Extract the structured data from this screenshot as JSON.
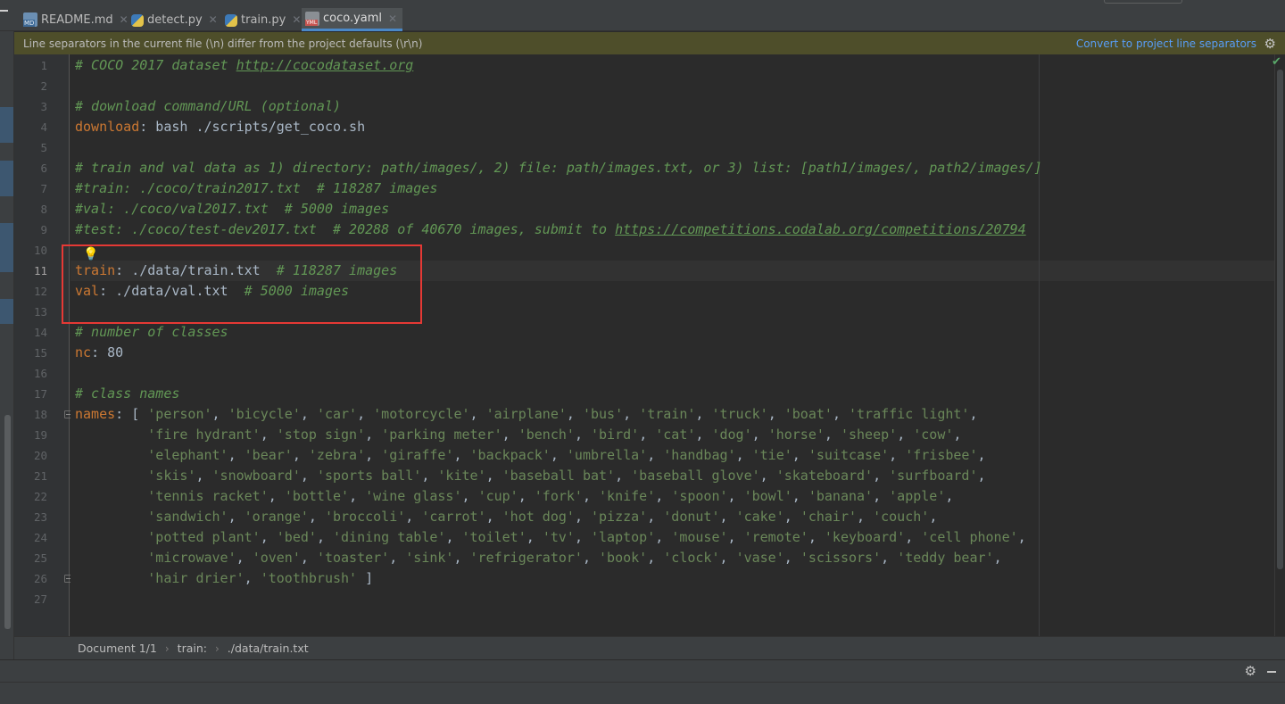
{
  "tabs": [
    {
      "label": "README.md",
      "icon": "markdown-file-icon"
    },
    {
      "label": "detect.py",
      "icon": "python-file-icon"
    },
    {
      "label": "train.py",
      "icon": "python-file-icon"
    },
    {
      "label": "coco.yaml",
      "icon": "yaml-file-icon",
      "active": true
    }
  ],
  "banner": {
    "message": "Line separators in the current file (\\n) differ from the project defaults (\\r\\n)",
    "action": "Convert to project line separators"
  },
  "editor": {
    "current_line": 11,
    "line_numbers": [
      "1",
      "2",
      "3",
      "4",
      "5",
      "6",
      "7",
      "8",
      "9",
      "10",
      "11",
      "12",
      "13",
      "14",
      "15",
      "16",
      "17",
      "18",
      "19",
      "20",
      "21",
      "22",
      "23",
      "24",
      "25",
      "26",
      "27"
    ],
    "lines": [
      [
        {
          "t": "c",
          "v": "# COCO 2017 dataset "
        },
        {
          "t": "cu",
          "v": "http://cocodataset.org"
        }
      ],
      [],
      [
        {
          "t": "c",
          "v": "# download command/URL (optional)"
        }
      ],
      [
        {
          "t": "k",
          "v": "download"
        },
        {
          "t": "p",
          "v": ": bash ./scripts/get_coco.sh"
        }
      ],
      [],
      [
        {
          "t": "c",
          "v": "# train and val data as 1) directory: path/images/, 2) file: path/images.txt, or 3) list: [path1/images/, path2/images/]"
        }
      ],
      [
        {
          "t": "c",
          "v": "#train: ./coco/train2017.txt  # 118287 images"
        }
      ],
      [
        {
          "t": "c",
          "v": "#val: ./coco/val2017.txt  # 5000 images"
        }
      ],
      [
        {
          "t": "c",
          "v": "#test: ./coco/test-dev2017.txt  # 20288 of 40670 images, submit to "
        },
        {
          "t": "cu",
          "v": "https://competitions.codalab.org/competitions/20794"
        }
      ],
      [],
      [
        {
          "t": "k",
          "v": "train"
        },
        {
          "t": "p",
          "v": ": ./data/train.txt  "
        },
        {
          "t": "c",
          "v": "# 118287 images"
        }
      ],
      [
        {
          "t": "k",
          "v": "val"
        },
        {
          "t": "p",
          "v": ": ./data/val.txt  "
        },
        {
          "t": "c",
          "v": "# 5000 images"
        }
      ],
      [],
      [
        {
          "t": "c",
          "v": "# number of classes"
        }
      ],
      [
        {
          "t": "k",
          "v": "nc"
        },
        {
          "t": "p",
          "v": ": 80"
        }
      ],
      [],
      [
        {
          "t": "c",
          "v": "# class names"
        }
      ],
      [
        {
          "t": "k",
          "v": "names"
        },
        {
          "t": "p",
          "v": ": [ "
        },
        {
          "t": "s",
          "v": "'person'"
        },
        {
          "t": "p",
          "v": ", "
        },
        {
          "t": "s",
          "v": "'bicycle'"
        },
        {
          "t": "p",
          "v": ", "
        },
        {
          "t": "s",
          "v": "'car'"
        },
        {
          "t": "p",
          "v": ", "
        },
        {
          "t": "s",
          "v": "'motorcycle'"
        },
        {
          "t": "p",
          "v": ", "
        },
        {
          "t": "s",
          "v": "'airplane'"
        },
        {
          "t": "p",
          "v": ", "
        },
        {
          "t": "s",
          "v": "'bus'"
        },
        {
          "t": "p",
          "v": ", "
        },
        {
          "t": "s",
          "v": "'train'"
        },
        {
          "t": "p",
          "v": ", "
        },
        {
          "t": "s",
          "v": "'truck'"
        },
        {
          "t": "p",
          "v": ", "
        },
        {
          "t": "s",
          "v": "'boat'"
        },
        {
          "t": "p",
          "v": ", "
        },
        {
          "t": "s",
          "v": "'traffic light'"
        },
        {
          "t": "p",
          "v": ","
        }
      ],
      [
        {
          "t": "p",
          "v": "         "
        },
        {
          "t": "s",
          "v": "'fire hydrant'"
        },
        {
          "t": "p",
          "v": ", "
        },
        {
          "t": "s",
          "v": "'stop sign'"
        },
        {
          "t": "p",
          "v": ", "
        },
        {
          "t": "s",
          "v": "'parking meter'"
        },
        {
          "t": "p",
          "v": ", "
        },
        {
          "t": "s",
          "v": "'bench'"
        },
        {
          "t": "p",
          "v": ", "
        },
        {
          "t": "s",
          "v": "'bird'"
        },
        {
          "t": "p",
          "v": ", "
        },
        {
          "t": "s",
          "v": "'cat'"
        },
        {
          "t": "p",
          "v": ", "
        },
        {
          "t": "s",
          "v": "'dog'"
        },
        {
          "t": "p",
          "v": ", "
        },
        {
          "t": "s",
          "v": "'horse'"
        },
        {
          "t": "p",
          "v": ", "
        },
        {
          "t": "s",
          "v": "'sheep'"
        },
        {
          "t": "p",
          "v": ", "
        },
        {
          "t": "s",
          "v": "'cow'"
        },
        {
          "t": "p",
          "v": ","
        }
      ],
      [
        {
          "t": "p",
          "v": "         "
        },
        {
          "t": "s",
          "v": "'elephant'"
        },
        {
          "t": "p",
          "v": ", "
        },
        {
          "t": "s",
          "v": "'bear'"
        },
        {
          "t": "p",
          "v": ", "
        },
        {
          "t": "s",
          "v": "'zebra'"
        },
        {
          "t": "p",
          "v": ", "
        },
        {
          "t": "s",
          "v": "'giraffe'"
        },
        {
          "t": "p",
          "v": ", "
        },
        {
          "t": "s",
          "v": "'backpack'"
        },
        {
          "t": "p",
          "v": ", "
        },
        {
          "t": "s",
          "v": "'umbrella'"
        },
        {
          "t": "p",
          "v": ", "
        },
        {
          "t": "s",
          "v": "'handbag'"
        },
        {
          "t": "p",
          "v": ", "
        },
        {
          "t": "s",
          "v": "'tie'"
        },
        {
          "t": "p",
          "v": ", "
        },
        {
          "t": "s",
          "v": "'suitcase'"
        },
        {
          "t": "p",
          "v": ", "
        },
        {
          "t": "s",
          "v": "'frisbee'"
        },
        {
          "t": "p",
          "v": ","
        }
      ],
      [
        {
          "t": "p",
          "v": "         "
        },
        {
          "t": "s",
          "v": "'skis'"
        },
        {
          "t": "p",
          "v": ", "
        },
        {
          "t": "s",
          "v": "'snowboard'"
        },
        {
          "t": "p",
          "v": ", "
        },
        {
          "t": "s",
          "v": "'sports ball'"
        },
        {
          "t": "p",
          "v": ", "
        },
        {
          "t": "s",
          "v": "'kite'"
        },
        {
          "t": "p",
          "v": ", "
        },
        {
          "t": "s",
          "v": "'baseball bat'"
        },
        {
          "t": "p",
          "v": ", "
        },
        {
          "t": "s",
          "v": "'baseball glove'"
        },
        {
          "t": "p",
          "v": ", "
        },
        {
          "t": "s",
          "v": "'skateboard'"
        },
        {
          "t": "p",
          "v": ", "
        },
        {
          "t": "s",
          "v": "'surfboard'"
        },
        {
          "t": "p",
          "v": ","
        }
      ],
      [
        {
          "t": "p",
          "v": "         "
        },
        {
          "t": "s",
          "v": "'tennis racket'"
        },
        {
          "t": "p",
          "v": ", "
        },
        {
          "t": "s",
          "v": "'bottle'"
        },
        {
          "t": "p",
          "v": ", "
        },
        {
          "t": "s",
          "v": "'wine glass'"
        },
        {
          "t": "p",
          "v": ", "
        },
        {
          "t": "s",
          "v": "'cup'"
        },
        {
          "t": "p",
          "v": ", "
        },
        {
          "t": "s",
          "v": "'fork'"
        },
        {
          "t": "p",
          "v": ", "
        },
        {
          "t": "s",
          "v": "'knife'"
        },
        {
          "t": "p",
          "v": ", "
        },
        {
          "t": "s",
          "v": "'spoon'"
        },
        {
          "t": "p",
          "v": ", "
        },
        {
          "t": "s",
          "v": "'bowl'"
        },
        {
          "t": "p",
          "v": ", "
        },
        {
          "t": "s",
          "v": "'banana'"
        },
        {
          "t": "p",
          "v": ", "
        },
        {
          "t": "s",
          "v": "'apple'"
        },
        {
          "t": "p",
          "v": ","
        }
      ],
      [
        {
          "t": "p",
          "v": "         "
        },
        {
          "t": "s",
          "v": "'sandwich'"
        },
        {
          "t": "p",
          "v": ", "
        },
        {
          "t": "s",
          "v": "'orange'"
        },
        {
          "t": "p",
          "v": ", "
        },
        {
          "t": "s",
          "v": "'broccoli'"
        },
        {
          "t": "p",
          "v": ", "
        },
        {
          "t": "s",
          "v": "'carrot'"
        },
        {
          "t": "p",
          "v": ", "
        },
        {
          "t": "s",
          "v": "'hot dog'"
        },
        {
          "t": "p",
          "v": ", "
        },
        {
          "t": "s",
          "v": "'pizza'"
        },
        {
          "t": "p",
          "v": ", "
        },
        {
          "t": "s",
          "v": "'donut'"
        },
        {
          "t": "p",
          "v": ", "
        },
        {
          "t": "s",
          "v": "'cake'"
        },
        {
          "t": "p",
          "v": ", "
        },
        {
          "t": "s",
          "v": "'chair'"
        },
        {
          "t": "p",
          "v": ", "
        },
        {
          "t": "s",
          "v": "'couch'"
        },
        {
          "t": "p",
          "v": ","
        }
      ],
      [
        {
          "t": "p",
          "v": "         "
        },
        {
          "t": "s",
          "v": "'potted plant'"
        },
        {
          "t": "p",
          "v": ", "
        },
        {
          "t": "s",
          "v": "'bed'"
        },
        {
          "t": "p",
          "v": ", "
        },
        {
          "t": "s",
          "v": "'dining table'"
        },
        {
          "t": "p",
          "v": ", "
        },
        {
          "t": "s",
          "v": "'toilet'"
        },
        {
          "t": "p",
          "v": ", "
        },
        {
          "t": "s",
          "v": "'tv'"
        },
        {
          "t": "p",
          "v": ", "
        },
        {
          "t": "s",
          "v": "'laptop'"
        },
        {
          "t": "p",
          "v": ", "
        },
        {
          "t": "s",
          "v": "'mouse'"
        },
        {
          "t": "p",
          "v": ", "
        },
        {
          "t": "s",
          "v": "'remote'"
        },
        {
          "t": "p",
          "v": ", "
        },
        {
          "t": "s",
          "v": "'keyboard'"
        },
        {
          "t": "p",
          "v": ", "
        },
        {
          "t": "s",
          "v": "'cell phone'"
        },
        {
          "t": "p",
          "v": ","
        }
      ],
      [
        {
          "t": "p",
          "v": "         "
        },
        {
          "t": "s",
          "v": "'microwave'"
        },
        {
          "t": "p",
          "v": ", "
        },
        {
          "t": "s",
          "v": "'oven'"
        },
        {
          "t": "p",
          "v": ", "
        },
        {
          "t": "s",
          "v": "'toaster'"
        },
        {
          "t": "p",
          "v": ", "
        },
        {
          "t": "s",
          "v": "'sink'"
        },
        {
          "t": "p",
          "v": ", "
        },
        {
          "t": "s",
          "v": "'refrigerator'"
        },
        {
          "t": "p",
          "v": ", "
        },
        {
          "t": "s",
          "v": "'book'"
        },
        {
          "t": "p",
          "v": ", "
        },
        {
          "t": "s",
          "v": "'clock'"
        },
        {
          "t": "p",
          "v": ", "
        },
        {
          "t": "s",
          "v": "'vase'"
        },
        {
          "t": "p",
          "v": ", "
        },
        {
          "t": "s",
          "v": "'scissors'"
        },
        {
          "t": "p",
          "v": ", "
        },
        {
          "t": "s",
          "v": "'teddy bear'"
        },
        {
          "t": "p",
          "v": ","
        }
      ],
      [
        {
          "t": "p",
          "v": "         "
        },
        {
          "t": "s",
          "v": "'hair drier'"
        },
        {
          "t": "p",
          "v": ", "
        },
        {
          "t": "s",
          "v": "'toothbrush'"
        },
        {
          "t": "p",
          "v": " ]"
        }
      ],
      []
    ]
  },
  "breadcrumb": [
    "Document 1/1",
    "train:",
    "./data/train.txt"
  ],
  "colors": {
    "comment": "#629755",
    "key": "#cc7832",
    "string": "#6a8759",
    "text": "#a9b7c6",
    "highlight_box": "#e53935",
    "banner_link": "#589df6"
  }
}
